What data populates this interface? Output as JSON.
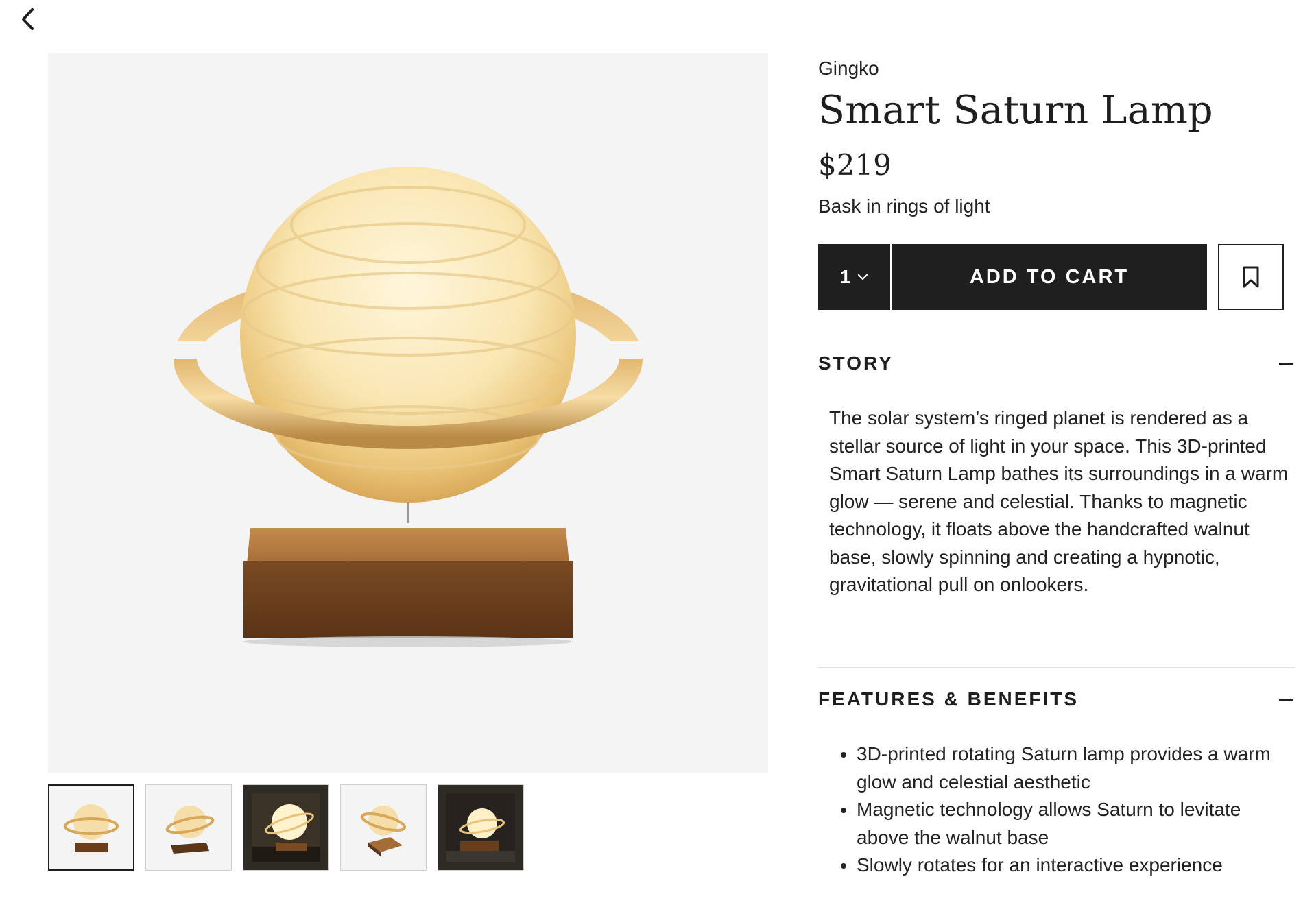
{
  "nav": {
    "back_icon": "chevron-left-icon"
  },
  "product": {
    "brand": "Gingko",
    "title": "Smart Saturn Lamp",
    "price": "$219",
    "tagline": "Bask in rings of light"
  },
  "purchase": {
    "quantity": "1",
    "add_to_cart_label": "ADD TO CART",
    "save_icon": "bookmark-icon"
  },
  "story": {
    "heading": "STORY",
    "text": "The solar system’s ringed planet is rendered as a stellar source of light in your space. This 3D-printed Smart Saturn Lamp bathes its surroundings in a warm glow — serene and celestial. Thanks to magnetic technology, it floats above the handcrafted walnut base, slowly spinning and creating a hypnotic, gravitational pull on onlookers."
  },
  "features": {
    "heading": "FEATURES & BENEFITS",
    "items": [
      "3D-printed rotating Saturn lamp provides a warm glow and celestial aesthetic",
      "Magnetic technology allows Saturn to levitate above the walnut base",
      "Slowly rotates for an interactive experience"
    ]
  },
  "gallery": {
    "thumbnail_count": 5,
    "selected_index": 0
  },
  "colors": {
    "button_bg": "#1f1f1f",
    "image_bg": "#f4f4f4",
    "walnut": "#8a5a2b",
    "glow": "#f6e3b0"
  }
}
